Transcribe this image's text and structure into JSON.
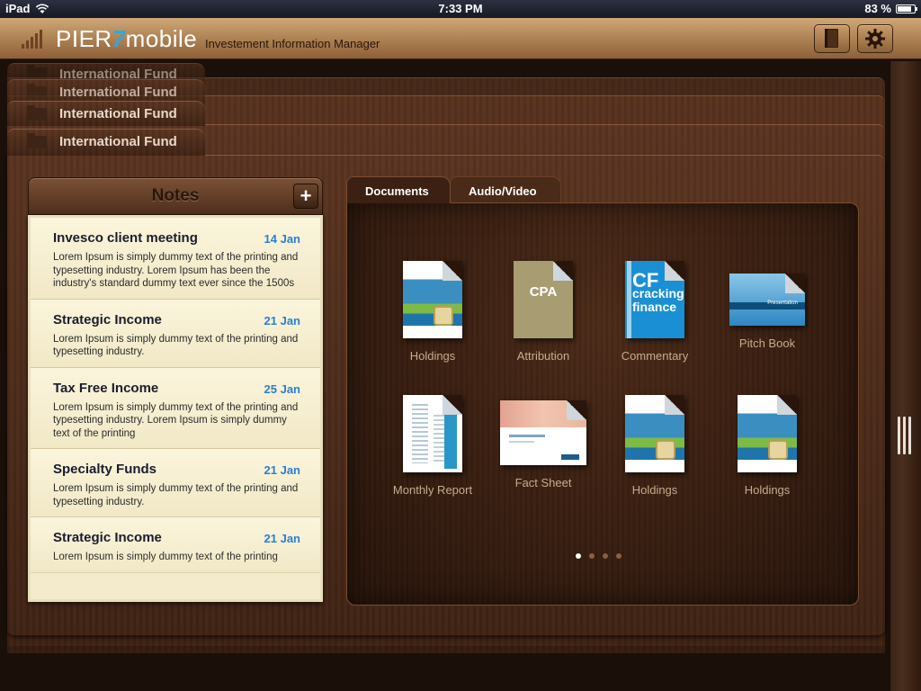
{
  "status_bar": {
    "device": "iPad",
    "time": "7:33 PM",
    "battery": "83 %",
    "battery_level": 0.83
  },
  "app": {
    "logo_pier": "PIER",
    "logo_seven": "7",
    "logo_mobile": "mobile",
    "subtitle": "Investement Information Manager",
    "buttons": {
      "book": "book-icon",
      "settings": "gear-icon"
    }
  },
  "folders": [
    "International Fund",
    "International Fund",
    "International Fund",
    "International Fund"
  ],
  "notes": {
    "title": "Notes",
    "add_label": "+",
    "items": [
      {
        "title": "Invesco client meeting",
        "date": "14 Jan",
        "body": "Lorem Ipsum is simply dummy text of the printing and typesetting industry. Lorem Ipsum has been the industry's standard dummy text ever since the 1500s"
      },
      {
        "title": "Strategic Income",
        "date": "21 Jan",
        "body": "Lorem Ipsum is simply dummy text of the printing and typesetting industry."
      },
      {
        "title": "Tax Free Income",
        "date": "25 Jan",
        "body": "Lorem Ipsum is simply dummy text of the printing and typesetting industry. Lorem Ipsum is simply dummy text of the printing"
      },
      {
        "title": "Specialty Funds",
        "date": "21 Jan",
        "body": "Lorem Ipsum is simply dummy text of the printing and typesetting industry."
      },
      {
        "title": "Strategic Income",
        "date": "21 Jan",
        "body": "Lorem Ipsum is simply dummy text of the printing"
      }
    ]
  },
  "tabs": {
    "documents": "Documents",
    "audio_video": "Audio/Video"
  },
  "documents": [
    {
      "label": "Holdings"
    },
    {
      "label": "Attribution",
      "cover_text": "CPA"
    },
    {
      "label": "Commentary",
      "cover_big": "CF",
      "cover_line1": "cracking",
      "cover_line2": "finance"
    },
    {
      "label": "Pitch Book",
      "cover_text": "Presentation"
    },
    {
      "label": "Monthly Report"
    },
    {
      "label": "Fact Sheet"
    },
    {
      "label": "Holdings"
    },
    {
      "label": "Holdings"
    }
  ],
  "pagination": {
    "pages": 4,
    "current": 1
  }
}
